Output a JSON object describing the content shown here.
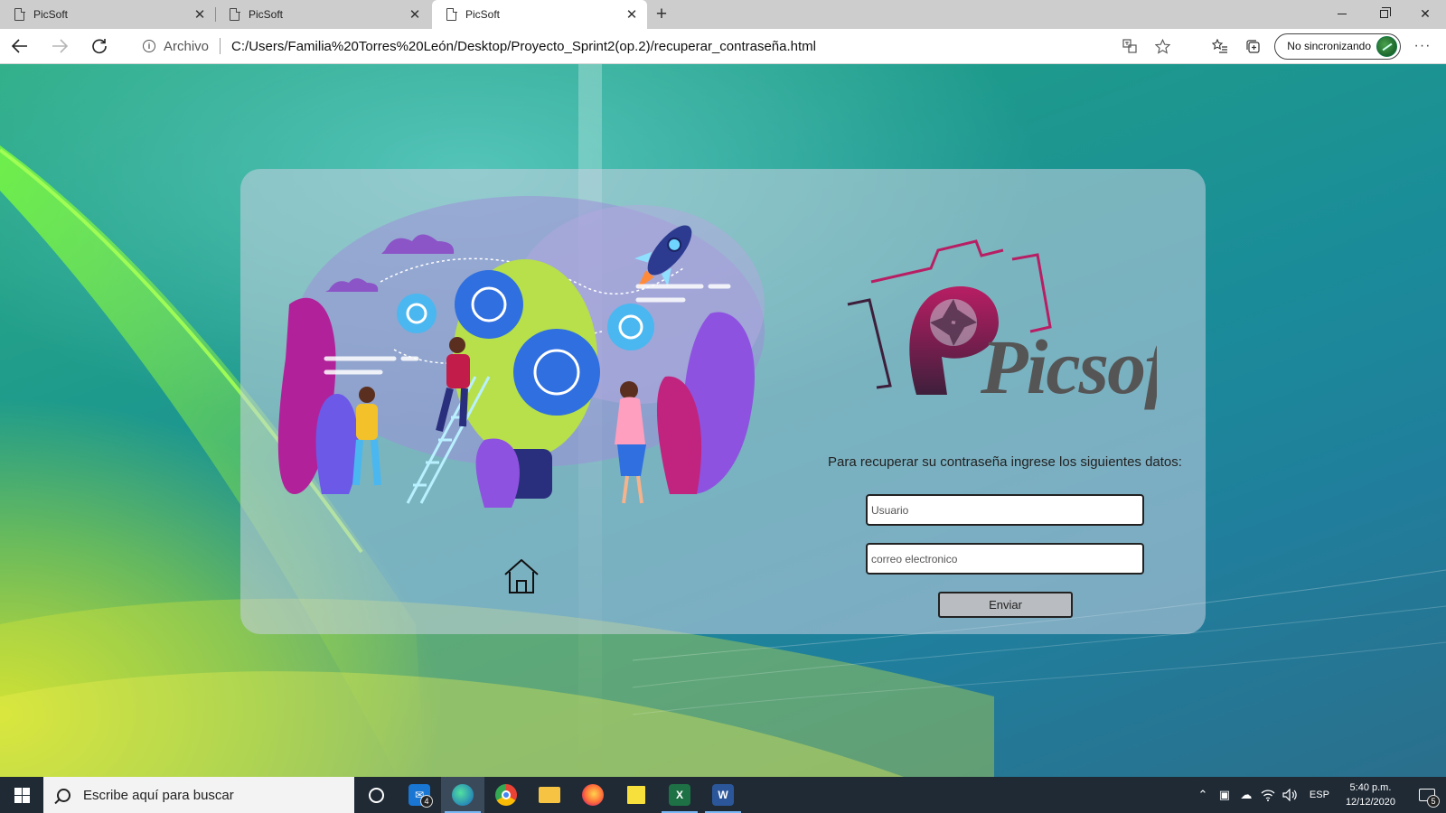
{
  "browser": {
    "tabs": [
      {
        "title": "PicSoft",
        "active": false
      },
      {
        "title": "PicSoft",
        "active": false
      },
      {
        "title": "PicSoft",
        "active": true
      }
    ],
    "new_tab_label": "+",
    "site_label": "Archivo",
    "url": "C:/Users/Familia%20Torres%20León/Desktop/Proyecto_Sprint2(op.2)/recuperar_contraseña.html",
    "sync_label": "No sincronizando",
    "window_controls": {
      "minimize": "minimize",
      "maximize": "restore",
      "close": "✕"
    }
  },
  "page": {
    "logo_text": "Picsoft",
    "instructions": "Para recuperar su contraseña ingrese los siguientes datos:",
    "username_placeholder": "Usuario",
    "email_placeholder": "correo electronico",
    "submit_label": "Enviar"
  },
  "colors": {
    "logo_primary": "#8e1a4e",
    "logo_text": "#5a5a5a",
    "card_bg": "rgba(200,210,225,0.55)",
    "taskbar_bg": "#1f2a35"
  },
  "taskbar": {
    "search_placeholder": "Escribe aquí para buscar",
    "mail_badge": "4",
    "apps": [
      "cortana-icon",
      "mail-icon",
      "edge-icon",
      "chrome-icon",
      "file-explorer-icon",
      "firefox-icon",
      "sticky-notes-icon",
      "excel-icon",
      "word-icon"
    ],
    "language": "ESP",
    "time": "5:40 p.m.",
    "date": "12/12/2020",
    "notification_count": "5"
  }
}
